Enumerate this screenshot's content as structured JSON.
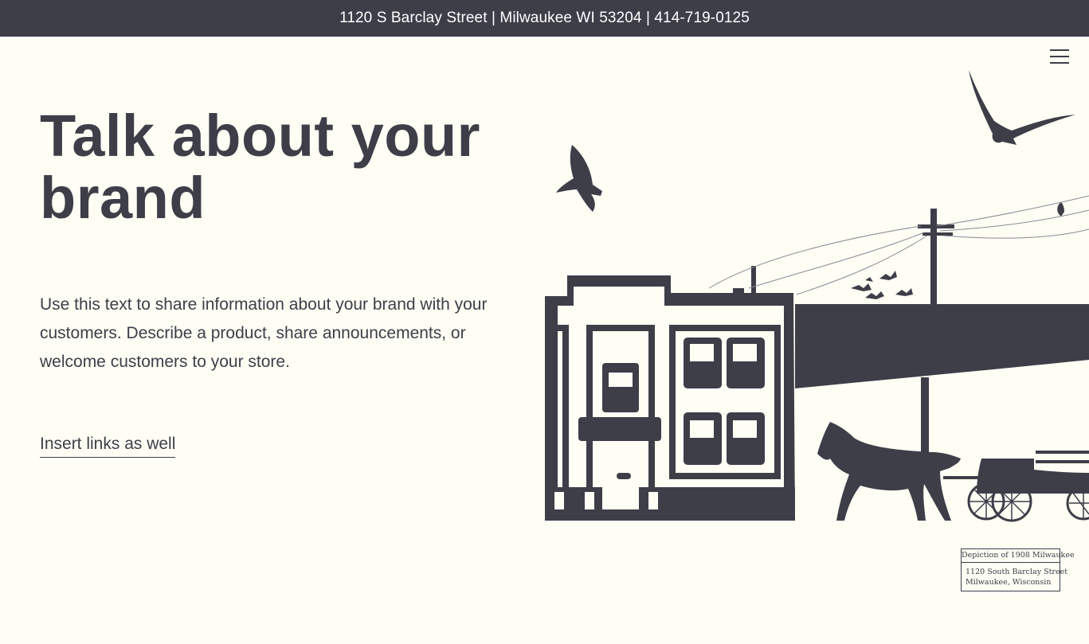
{
  "topbar": {
    "text": "1120 S Barclay Street | Milwaukee WI 53204 | 414-719-0125"
  },
  "menu": {
    "icon": "hamburger-menu-icon"
  },
  "hero": {
    "heading": "Talk about your brand",
    "body": "Use this text to share information about your brand with your customers. Describe a product, share announcements, or welcome customers to your store.",
    "link": "Insert links as well"
  },
  "caption": {
    "title": "Depiction of 1908 Milwaukee",
    "line1": "1120 South Barclay Street",
    "line2": "Milwaukee, Wisconsin"
  },
  "colors": {
    "dark": "#3d3e48",
    "background": "#fefef5",
    "topbar_text": "#ffffff"
  }
}
